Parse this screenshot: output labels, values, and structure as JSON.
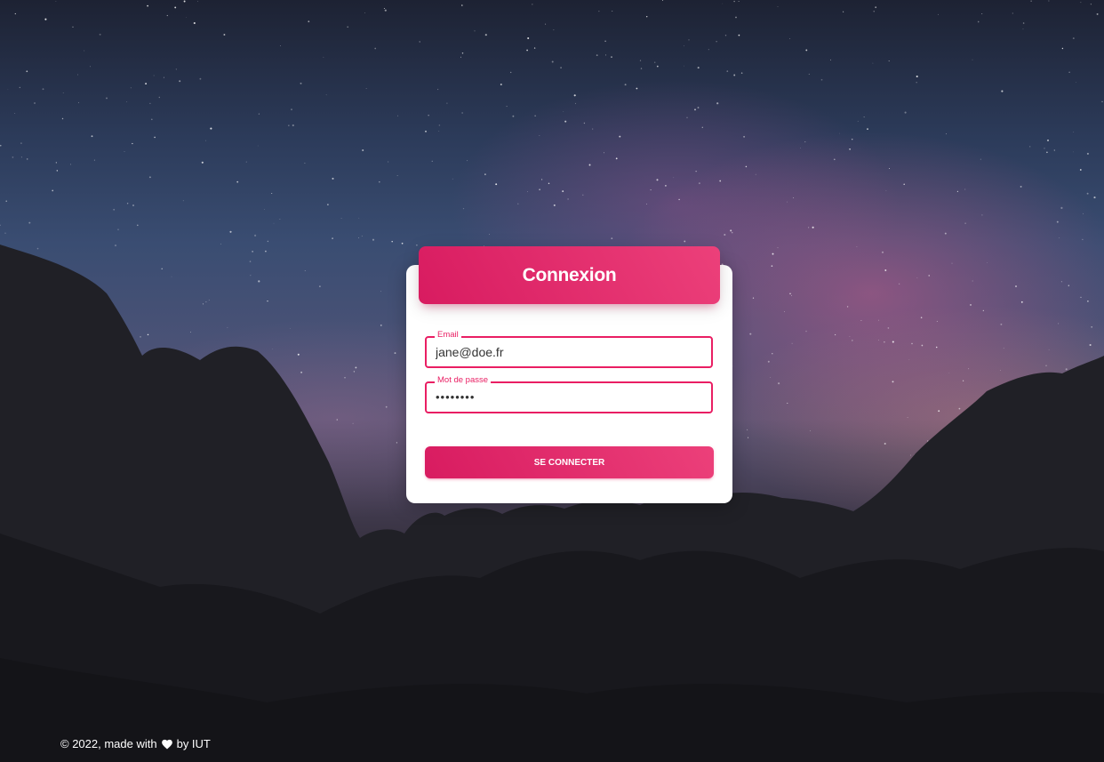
{
  "login_card": {
    "title": "Connexion",
    "email": {
      "label": "Email",
      "value": "jane@doe.fr"
    },
    "password": {
      "label": "Mot de passe",
      "masked_value": "••••••••"
    },
    "submit_label": "SE CONNECTER"
  },
  "footer": {
    "prefix": "© 2022, made with",
    "icon": "heart-icon",
    "suffix": "by IUT"
  },
  "colors": {
    "accent": "#e91e63",
    "card_background": "#ffffff"
  }
}
